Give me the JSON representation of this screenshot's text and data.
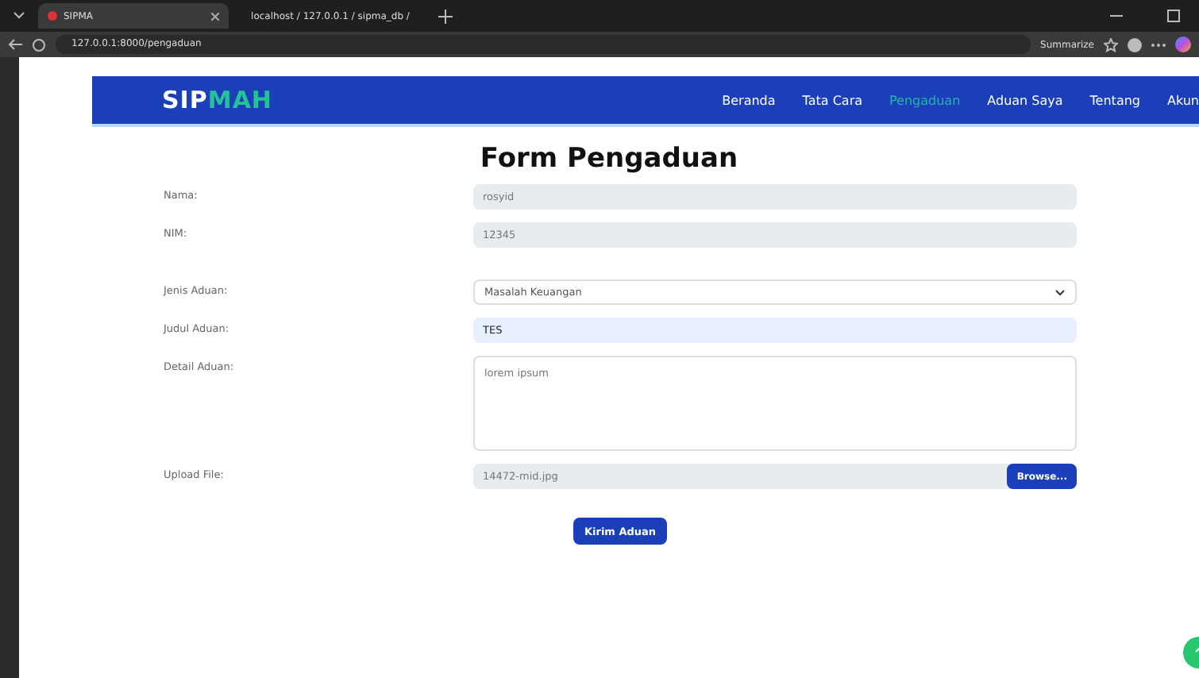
{
  "browser": {
    "tabs": [
      {
        "label": "SIPMA",
        "selected": true
      },
      {
        "label": "localhost / 127.0.0.1 / sipma_db /",
        "selected": false
      }
    ],
    "address": "127.0.0.1:8000/pengaduan",
    "summarize": "Summarize"
  },
  "navbar": {
    "logo_a": "SIP",
    "logo_b": "MAH",
    "items": [
      {
        "label": "Beranda",
        "selected": false
      },
      {
        "label": "Tata Cara",
        "selected": false
      },
      {
        "label": "Pengaduan",
        "selected": true
      },
      {
        "label": "Aduan Saya",
        "selected": false
      },
      {
        "label": "Tentang",
        "selected": false
      },
      {
        "label": "Akun",
        "selected": false
      }
    ]
  },
  "form": {
    "title": "Form Pengaduan",
    "fields": [
      {
        "kind": "readonly",
        "label": "Nama:",
        "value": "rosyid"
      },
      {
        "kind": "readonly",
        "label": "NIM:",
        "value": "12345"
      },
      {
        "kind": "select",
        "label": "Jenis Aduan:",
        "value": "Masalah Keuangan"
      },
      {
        "kind": "text",
        "label": "Judul Aduan:",
        "value": "TES"
      },
      {
        "kind": "textarea",
        "label": "Detail Aduan:",
        "value": "lorem ipsum"
      },
      {
        "kind": "file",
        "label": "Upload File:",
        "value": "14472-mid.jpg",
        "button": "Browse..."
      }
    ],
    "submit": "Kirim Aduan"
  }
}
